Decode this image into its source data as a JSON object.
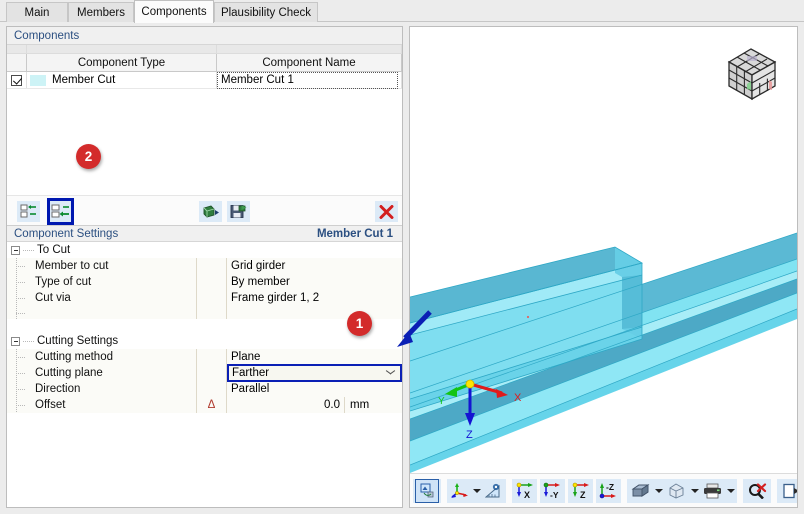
{
  "tabs": [
    {
      "label": "Main",
      "active": false
    },
    {
      "label": "Members",
      "active": false
    },
    {
      "label": "Components",
      "active": true
    },
    {
      "label": "Plausibility Check",
      "active": false
    }
  ],
  "components_panel": {
    "title": "Components",
    "columns": [
      "",
      "Component Type",
      "Component Name"
    ],
    "rows": [
      {
        "checked": true,
        "swatch_color": "#cdf3f6",
        "type": "Member Cut",
        "name": "Member Cut 1",
        "name_selected": true
      }
    ],
    "toolbar": {
      "new_component_label": "New Component",
      "insert_component_label": "Insert Component",
      "import_label": "Import Component",
      "save_label": "Save Component",
      "delete_label": "Delete Component"
    }
  },
  "component_settings": {
    "title": "Component Settings",
    "subject": "Member Cut 1",
    "groups": [
      {
        "label": "To Cut",
        "expanded": true,
        "rows": [
          {
            "label": "Member to cut",
            "symbol": "",
            "value": "Grid girder",
            "unit": ""
          },
          {
            "label": "Type of cut",
            "symbol": "",
            "value": "By member",
            "unit": ""
          },
          {
            "label": "Cut via",
            "symbol": "",
            "value": "Frame girder 1, 2",
            "unit": ""
          }
        ]
      },
      {
        "label": "Cutting Settings",
        "expanded": true,
        "rows": [
          {
            "label": "Cutting method",
            "symbol": "",
            "value": "Plane",
            "unit": ""
          },
          {
            "label": "Cutting plane",
            "symbol": "",
            "value": "Farther",
            "unit": "",
            "is_combo": true,
            "highlighted": true
          },
          {
            "label": "Direction",
            "symbol": "",
            "value": "Parallel",
            "unit": ""
          },
          {
            "label": "Offset",
            "symbol": "Δ",
            "value": "0.0",
            "unit": "mm",
            "numeric": true
          }
        ]
      }
    ]
  },
  "viewport": {
    "axes": {
      "x_label": "X",
      "y_label": "Y",
      "z_label": "Z"
    },
    "navcube_label": "view-cube",
    "toolbar": [
      {
        "name": "render-mode-button",
        "label": "Rendering Mode",
        "selected": true
      },
      {
        "name": "coordinate-system-button",
        "label": "Coordinate Systems",
        "has_dropdown": true
      },
      {
        "name": "measure-button",
        "label": "Measure"
      },
      {
        "name": "view-x-button",
        "label": "X"
      },
      {
        "name": "view-neg-y-button",
        "label": "-Y"
      },
      {
        "name": "view-z-button",
        "label": "Z"
      },
      {
        "name": "view-neg-z-button",
        "label": "-Z"
      },
      {
        "name": "display-style-button",
        "label": "Display Style",
        "has_dropdown": true
      },
      {
        "name": "view-box-button",
        "label": "Box View",
        "has_dropdown": true
      },
      {
        "name": "print-button",
        "label": "Print",
        "has_dropdown": true
      },
      {
        "name": "zoom-reset-button",
        "label": "Reset Zoom"
      },
      {
        "name": "panel-toggle-button",
        "label": "Toggle Panel"
      }
    ]
  },
  "annotations": [
    {
      "id": 1,
      "label": "1",
      "color": "#d32b2b"
    },
    {
      "id": 2,
      "label": "2",
      "color": "#d32b2b"
    }
  ]
}
